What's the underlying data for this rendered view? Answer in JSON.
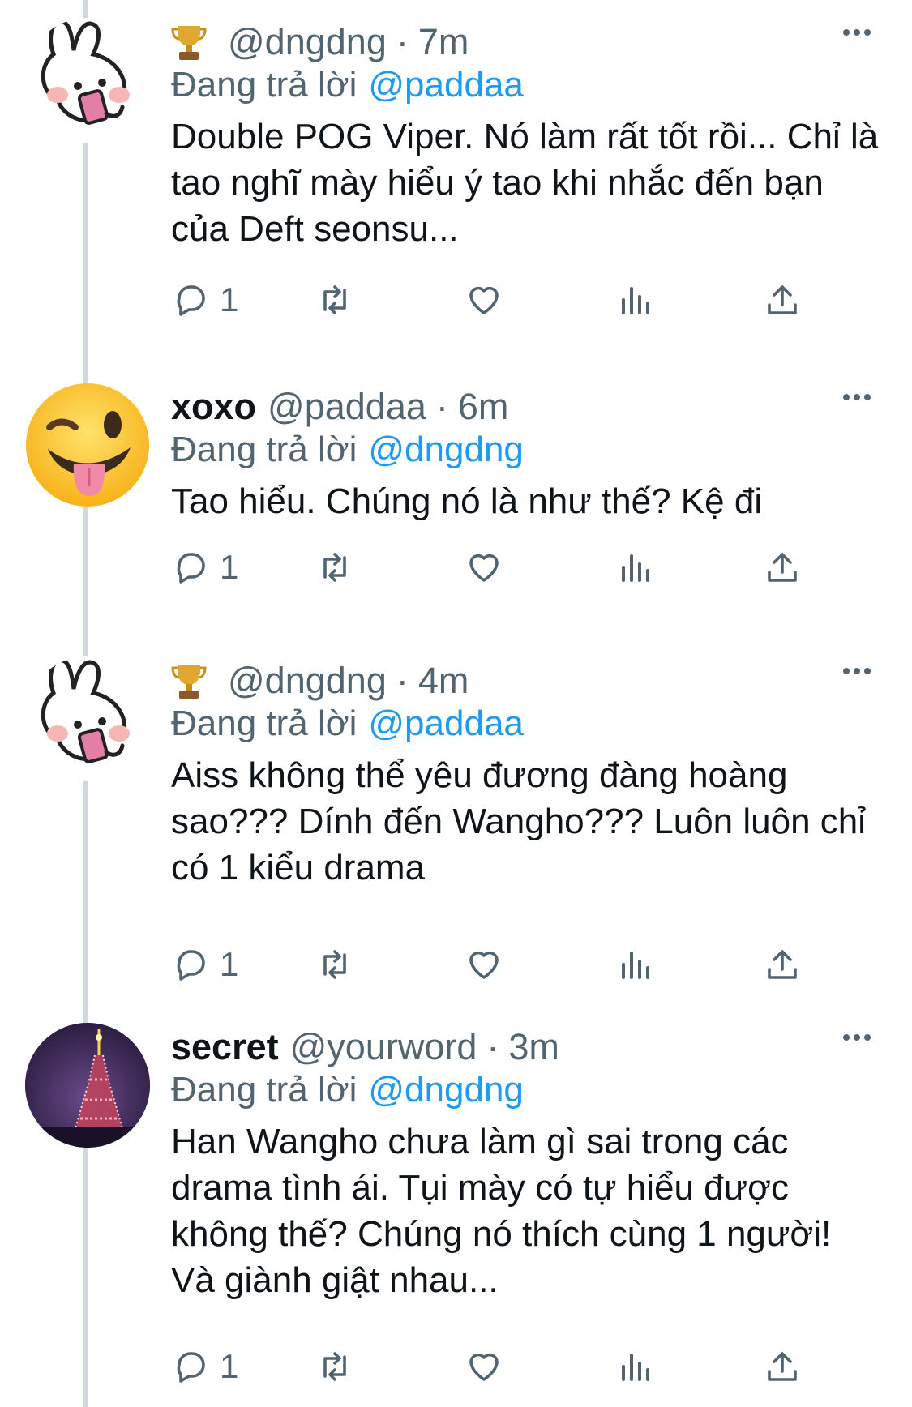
{
  "labels": {
    "reply_prefix": "Đang trả lời"
  },
  "colors": {
    "mention": "#1d9bf0",
    "secondary": "#536471",
    "thread_line": "#cfd9de"
  },
  "tweets": [
    {
      "avatar": "bunny-phone-avatar",
      "badge_icon": "trophy-icon",
      "name": "",
      "handle": "@dngdng",
      "time": "7m",
      "reply_to": "@paddaa",
      "text": "Double POG Viper. Nó làm rất tốt rồi... Chỉ là tao nghĩ mày hiểu ý tao khi nhắc đến bạn của Deft seonsu...",
      "reply_count": "1"
    },
    {
      "avatar": "tongue-wink-emoji-avatar",
      "badge_icon": "",
      "name": "xoxo",
      "handle": "@paddaa",
      "time": "6m",
      "reply_to": "@dngdng",
      "text": "Tao hiểu. Chúng nó là như thế? Kệ đi",
      "reply_count": "1"
    },
    {
      "avatar": "bunny-phone-avatar",
      "badge_icon": "trophy-icon",
      "name": "",
      "handle": "@dngdng",
      "time": "4m",
      "reply_to": "@paddaa",
      "text": "Aiss không thể yêu đương đàng hoàng sao??? Dính đến Wangho??? Luôn luôn chỉ có 1 kiểu drama",
      "reply_count": "1"
    },
    {
      "avatar": "tokyo-tower-night-avatar",
      "badge_icon": "",
      "name": "secret",
      "handle": "@yourword",
      "time": "3m",
      "reply_to": "@dngdng",
      "text": "Han Wangho chưa làm gì sai trong các drama tình ái. Tụi mày có tự hiểu được không thế? Chúng nó thích cùng 1 người! Và giành giật nhau...",
      "reply_count": "1"
    }
  ]
}
